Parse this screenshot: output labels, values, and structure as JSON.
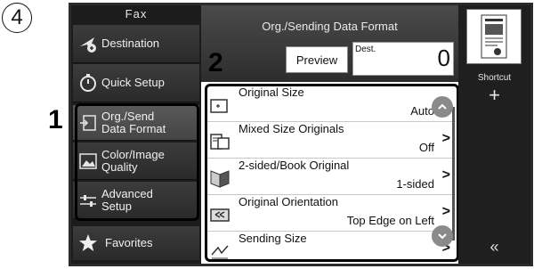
{
  "step_number": "4",
  "callouts": {
    "one": "1",
    "two": "2"
  },
  "sidebar": {
    "title": "Fax",
    "items": [
      {
        "label": "Destination",
        "icon": "destination-icon"
      },
      {
        "label": "Quick Setup",
        "icon": "stopwatch-icon"
      },
      {
        "label_line1": "Org./Send",
        "label_line2": "Data Format",
        "icon": "original-format-icon",
        "selected": true
      },
      {
        "label_line1": "Color/Image",
        "label_line2": "Quality",
        "icon": "color-image-icon"
      },
      {
        "label_line1": "Advanced",
        "label_line2": "Setup",
        "icon": "sliders-icon"
      }
    ],
    "favorites": "Favorites"
  },
  "main": {
    "title": "Org./Sending Data Format",
    "preview_label": "Preview",
    "dest_label": "Dest.",
    "dest_count": "0",
    "rows": [
      {
        "name": "Original Size",
        "value": "Auto"
      },
      {
        "name": "Mixed Size Originals",
        "value": "Off"
      },
      {
        "name": "2-sided/Book Original",
        "value": "1-sided"
      },
      {
        "name": "Original Orientation",
        "value": "Top Edge on Left"
      },
      {
        "name": "Sending Size",
        "value": ""
      }
    ]
  },
  "right": {
    "shortcut_label": "Shortcut",
    "plus": "+",
    "collapse": "«"
  },
  "colors": {
    "dark_panel": "#1c1c1c",
    "button_gradient_top": "#3c3c3c",
    "scroll_button": "#8a8a8a"
  }
}
